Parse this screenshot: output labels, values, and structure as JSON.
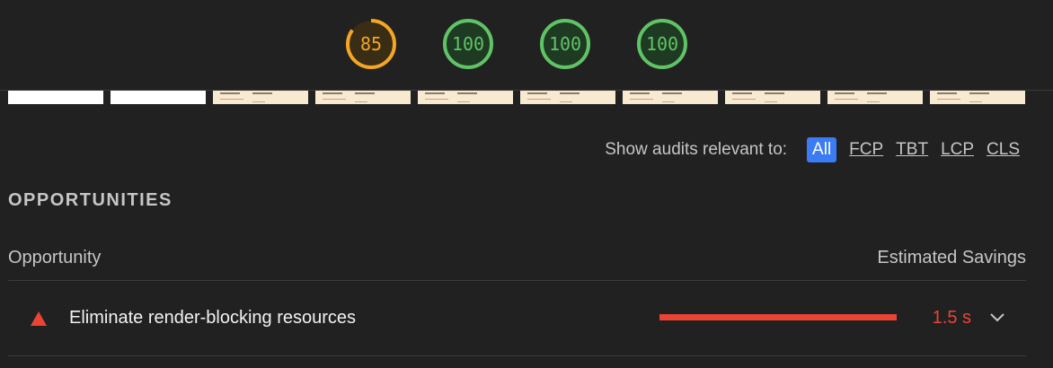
{
  "scores": [
    {
      "value": "85",
      "status": "average",
      "color": "#f5a623",
      "fill": 0.85
    },
    {
      "value": "100",
      "status": "pass",
      "color": "#5fc466",
      "fill": 1.0
    },
    {
      "value": "100",
      "status": "pass",
      "color": "#5fc466",
      "fill": 1.0
    },
    {
      "value": "100",
      "status": "pass",
      "color": "#5fc466",
      "fill": 1.0
    }
  ],
  "filmstrip": {
    "frames": [
      "blank",
      "blank",
      "loaded",
      "loaded",
      "loaded",
      "loaded",
      "loaded",
      "loaded",
      "loaded",
      "loaded"
    ]
  },
  "filter": {
    "label": "Show audits relevant to:",
    "chips": [
      {
        "label": "All",
        "active": true
      },
      {
        "label": "FCP",
        "active": false
      },
      {
        "label": "TBT",
        "active": false
      },
      {
        "label": "LCP",
        "active": false
      },
      {
        "label": "CLS",
        "active": false
      }
    ]
  },
  "opportunities": {
    "section_title": "OPPORTUNITIES",
    "col_opportunity": "Opportunity",
    "col_savings": "Estimated Savings",
    "items": [
      {
        "title": "Eliminate render-blocking resources",
        "savings": "1.5 s",
        "severity": "fail",
        "icon": "warning-triangle-icon",
        "expand_icon": "chevron-down-icon",
        "color": "#eb4435"
      }
    ]
  }
}
